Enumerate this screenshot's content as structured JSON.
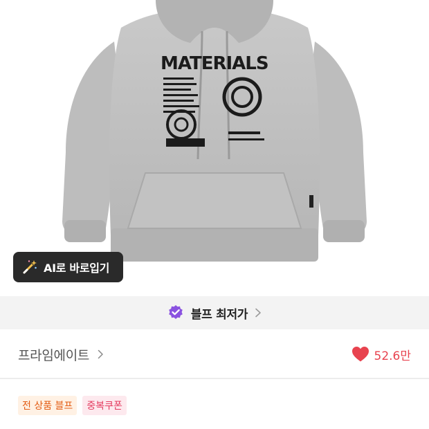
{
  "ai_tryon": {
    "label": "AI로 바로입기",
    "icon": "magic-wand-icon"
  },
  "best_price": {
    "label": "블프 최저가",
    "badge_icon": "verified-badge-icon",
    "accent": "#8a52e0"
  },
  "brand": {
    "name": "프라임에이트",
    "likes": "52.6만",
    "heart_color": "#e8434f"
  },
  "tags": [
    {
      "label": "전 상품 블프",
      "text_color": "#e35b12",
      "bg": "#fff1e4"
    },
    {
      "label": "중복쿠폰",
      "text_color": "#e43b5f",
      "bg": "#fde9ee"
    }
  ],
  "product": {
    "print_text": "MATERIALS"
  }
}
